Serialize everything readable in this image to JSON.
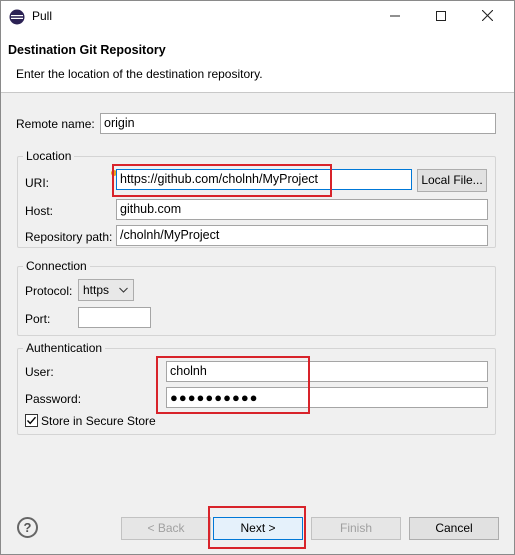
{
  "window": {
    "title": "Pull",
    "icon": "eclipse-icon"
  },
  "banner": {
    "title": "Destination Git Repository",
    "description": "Enter the location of the destination repository."
  },
  "remote": {
    "label": "Remote name:",
    "value": "origin"
  },
  "location": {
    "group_title": "Location",
    "uri_label": "URI:",
    "uri_value": "https://github.com/cholnh/MyProject",
    "local_file_button": "Local File...",
    "host_label": "Host:",
    "host_value": "github.com",
    "repo_path_label": "Repository path:",
    "repo_path_value": "/cholnh/MyProject"
  },
  "connection": {
    "group_title": "Connection",
    "protocol_label": "Protocol:",
    "protocol_value": "https",
    "port_label": "Port:",
    "port_value": ""
  },
  "authentication": {
    "group_title": "Authentication",
    "user_label": "User:",
    "user_value": "cholnh",
    "password_label": "Password:",
    "password_value": "●●●●●●●●●●",
    "store_label": "Store in Secure Store",
    "store_checked": true
  },
  "buttons": {
    "back": "< Back",
    "next": "Next >",
    "finish": "Finish",
    "cancel": "Cancel"
  },
  "colors": {
    "highlight": "#d8232a",
    "default_button_border": "#0078d7"
  }
}
